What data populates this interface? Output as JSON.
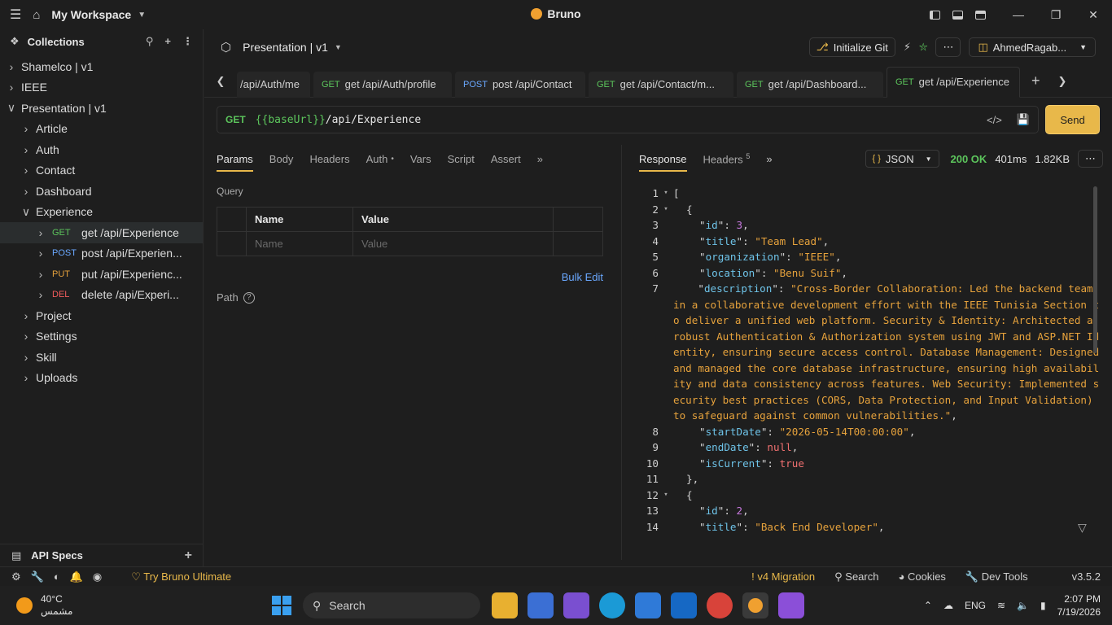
{
  "titlebar": {
    "workspace": "My Workspace",
    "app_name": "Bruno"
  },
  "sidebar": {
    "header": "Collections",
    "items": [
      {
        "label": "Shamelco | v1",
        "level": 0,
        "chevron": "right"
      },
      {
        "label": "IEEE",
        "level": 0,
        "chevron": "right"
      },
      {
        "label": "Presentation | v1",
        "level": 0,
        "chevron": "down"
      },
      {
        "label": "Article",
        "level": 1,
        "chevron": "right"
      },
      {
        "label": "Auth",
        "level": 1,
        "chevron": "right"
      },
      {
        "label": "Contact",
        "level": 1,
        "chevron": "right"
      },
      {
        "label": "Dashboard",
        "level": 1,
        "chevron": "right"
      },
      {
        "label": "Experience",
        "level": 1,
        "chevron": "down"
      },
      {
        "label": "get /api/Experience",
        "level": 2,
        "chevron": "right",
        "method": "GET",
        "active": true
      },
      {
        "label": "post /api/Experien...",
        "level": 2,
        "chevron": "right",
        "method": "POST"
      },
      {
        "label": "put /api/Experienc...",
        "level": 2,
        "chevron": "right",
        "method": "PUT"
      },
      {
        "label": "delete /api/Experi...",
        "level": 2,
        "chevron": "right",
        "method": "DEL"
      },
      {
        "label": "Project",
        "level": 1,
        "chevron": "right"
      },
      {
        "label": "Settings",
        "level": 1,
        "chevron": "right"
      },
      {
        "label": "Skill",
        "level": 1,
        "chevron": "right"
      },
      {
        "label": "Uploads",
        "level": 1,
        "chevron": "right"
      }
    ],
    "api_specs": "API Specs"
  },
  "topbar": {
    "collection": "Presentation | v1",
    "init_git": "Initialize Git",
    "user": "AhmedRagab..."
  },
  "tabs": [
    {
      "method": "",
      "label": "/api/Auth/me"
    },
    {
      "method": "GET",
      "label": "get /api/Auth/profile"
    },
    {
      "method": "POST",
      "label": "post /api/Contact"
    },
    {
      "method": "GET",
      "label": "get /api/Contact/m..."
    },
    {
      "method": "GET",
      "label": "get /api/Dashboard..."
    },
    {
      "method": "GET",
      "label": "get /api/Experience",
      "active": true
    }
  ],
  "request": {
    "verb": "GET",
    "url_var": "{{baseUrl}}",
    "url_path": "/api/Experience",
    "send": "Send",
    "subtabs": [
      "Params",
      "Body",
      "Headers",
      "Auth",
      "Vars",
      "Script",
      "Assert"
    ],
    "query_label": "Query",
    "col_name": "Name",
    "col_value": "Value",
    "ph_name": "Name",
    "ph_value": "Value",
    "bulk_edit": "Bulk Edit",
    "path_label": "Path"
  },
  "response": {
    "tab_response": "Response",
    "tab_headers": "Headers",
    "headers_count": "5",
    "format": "JSON",
    "status": "200 OK",
    "time": "401ms",
    "size": "1.82KB",
    "lines": [
      {
        "n": "1",
        "fold": true,
        "indent": 0,
        "text": "["
      },
      {
        "n": "2",
        "fold": true,
        "indent": 1,
        "text": "{"
      },
      {
        "n": "3",
        "indent": 2,
        "key": "id",
        "val": "3",
        "type": "num"
      },
      {
        "n": "4",
        "indent": 2,
        "key": "title",
        "val": "\"Team Lead\"",
        "type": "str"
      },
      {
        "n": "5",
        "indent": 2,
        "key": "organization",
        "val": "\"IEEE\"",
        "type": "str"
      },
      {
        "n": "6",
        "indent": 2,
        "key": "location",
        "val": "\"Benu Suif\"",
        "type": "str"
      },
      {
        "n": "7",
        "indent": 2,
        "key": "description",
        "val": "\"Cross-Border Collaboration: Led the backend team in a collaborative development effort with the IEEE Tunisia Section to deliver a unified web platform. Security & Identity: Architected a robust Authentication & Authorization system using JWT and ASP.NET Identity, ensuring secure access control. Database Management: Designed and managed the core database infrastructure, ensuring high availability and data consistency across features. Web Security: Implemented security best practices (CORS, Data Protection, and Input Validation) to safeguard against common vulnerabilities.\"",
        "type": "long"
      },
      {
        "n": "8",
        "indent": 2,
        "key": "startDate",
        "val": "\"2026-05-14T00:00:00\"",
        "type": "str"
      },
      {
        "n": "9",
        "indent": 2,
        "key": "endDate",
        "val": "null",
        "type": "kw"
      },
      {
        "n": "10",
        "indent": 2,
        "key": "isCurrent",
        "val": "true",
        "type": "kw",
        "last": true
      },
      {
        "n": "11",
        "indent": 1,
        "text": "},"
      },
      {
        "n": "12",
        "fold": true,
        "indent": 1,
        "text": "{"
      },
      {
        "n": "13",
        "indent": 2,
        "key": "id",
        "val": "2",
        "type": "num"
      },
      {
        "n": "14",
        "indent": 2,
        "key": "title",
        "val": "\"Back End Developer\"",
        "type": "str"
      }
    ]
  },
  "statusbar": {
    "try": "Try Bruno Ultimate",
    "migration": "! v4 Migration",
    "search": "Search",
    "cookies": "Cookies",
    "devtools": "Dev Tools",
    "version": "v3.5.2"
  },
  "taskbar": {
    "temp": "40°C",
    "weather": "مشمس",
    "search": "Search",
    "lang": "ENG",
    "time": "2:07 PM",
    "date": "7/19/2026"
  }
}
